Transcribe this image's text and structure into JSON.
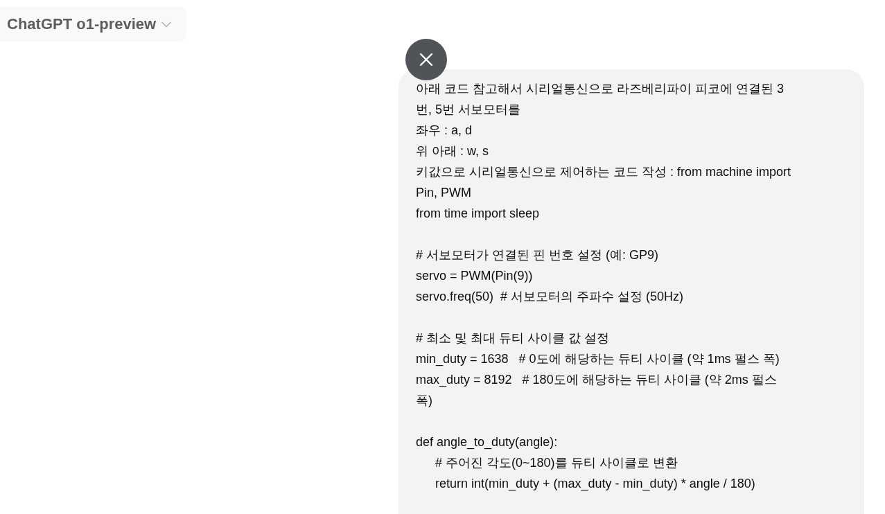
{
  "header": {
    "model_selector": {
      "label": "ChatGPT o1-preview"
    }
  },
  "user_message": {
    "blocks": [
      {
        "lines": [
          {
            "text": "아래 코드 참고해서 시리얼통신으로 라즈베리파이 피코에 연결된 3"
          },
          {
            "text": "번, 5번 서보모터를"
          },
          {
            "text": "좌우 : a, d"
          },
          {
            "text": "위 아래 : w, s"
          },
          {
            "text": "키값으로 시리얼통신으로 제어하는 코드 작성 : from machine import"
          },
          {
            "text": "Pin, PWM"
          },
          {
            "text": "from time import sleep"
          }
        ]
      },
      {
        "lines": [
          {
            "text": "# 서보모터가 연결된 핀 번호 설정 (예: GP9)"
          },
          {
            "text": "servo = PWM(Pin(9))"
          },
          {
            "text": "servo.freq(50)  # 서보모터의 주파수 설정 (50Hz)"
          }
        ]
      },
      {
        "lines": [
          {
            "text": "# 최소 및 최대 듀티 사이클 값 설정"
          },
          {
            "text": "min_duty = 1638   # 0도에 해당하는 듀티 사이클 (약 1ms 펄스 폭)"
          },
          {
            "text": "max_duty = 8192   # 180도에 해당하는 듀티 사이클 (약 2ms 펄스"
          },
          {
            "text": "폭)"
          }
        ]
      },
      {
        "lines": [
          {
            "text": "def angle_to_duty(angle):",
            "children": [
              {
                "text": "# 주어진 각도(0~180)를 듀티 사이클로 변환"
              },
              {
                "text": "return int(min_duty + (max_duty - min_duty) * angle / 180)"
              }
            ]
          }
        ]
      }
    ]
  }
}
